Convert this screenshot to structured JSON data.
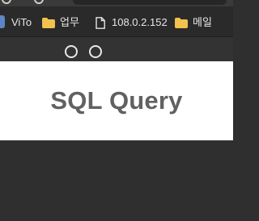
{
  "bookmarks_bar": {
    "items": [
      {
        "label": "ViTo",
        "icon": "bookmark-icon"
      },
      {
        "label": "업무",
        "icon": "folder-icon"
      },
      {
        "label": "108.0.2.152",
        "icon": "file-icon"
      },
      {
        "label": "메일",
        "icon": "folder-icon"
      }
    ]
  },
  "toolbar": {
    "buttons": [
      {
        "icon": "circle-outline-icon"
      },
      {
        "icon": "circle-outline-icon"
      }
    ]
  },
  "main": {
    "title": "SQL Query"
  },
  "colors": {
    "page_background": "#2f2f2f",
    "bookmarks_bar_background": "#2a2a2a",
    "title_panel_background": "#ffffff",
    "title_text": "#616161",
    "folder_icon": "#f2c14e",
    "bookmark_text": "#e6e6e6"
  }
}
